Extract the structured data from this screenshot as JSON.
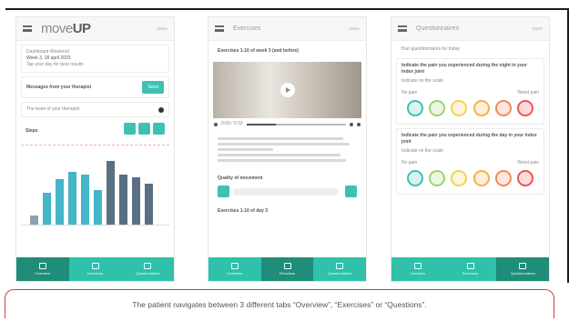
{
  "caption": "The patient navigates between 3 different tabs “Overview”, “Exercises” or “Questions”.",
  "colors": {
    "teal": "#3ec1b3",
    "teal_dark": "#208c7a",
    "bar_dark": "#5a6f82",
    "bar_light": "#45b5c8",
    "caption_border": "#d43a3a"
  },
  "phone1": {
    "logo_light": "move",
    "logo_bold": "UP",
    "card1": {
      "line1": "Dashboard Weekend",
      "line2": "Week 3, 18 april 2023",
      "line3": "Tap your day for best results"
    },
    "card2": {
      "message": "Messages from your therapist",
      "button": "Send"
    },
    "card3": {
      "text": "The team of your therapist"
    },
    "chart_header": "Steps",
    "tabs": [
      {
        "label": "Overview"
      },
      {
        "label": "Exercises"
      },
      {
        "label": "Questionnaires"
      }
    ]
  },
  "phone2": {
    "title": "Exercises",
    "heading": "Exercises 1-10 of week 3 (and before)",
    "video_time": "0:00 / 0:33",
    "quality_label": "Quality of movement",
    "footer_text": "Exercises 1-10 of day 3",
    "tabs": [
      {
        "label": "Overview"
      },
      {
        "label": "Exercises"
      },
      {
        "label": "Questionnaires"
      }
    ]
  },
  "phone3": {
    "title": "Questionnaires",
    "subtitle": "Your questionnaires for today",
    "q1": {
      "text": "Indicate the pain you experienced during the night in your index joint",
      "hint": "Indicate on the scale",
      "left": "No pain",
      "right": "Worst pain"
    },
    "q2": {
      "text": "Indicate the pain you experienced during the day in your index joint",
      "hint": "Indicate on the scale",
      "left": "No pain",
      "right": "Worst pain"
    },
    "face_colors": [
      "#3ec1b3",
      "#9fd46a",
      "#f4d24e",
      "#f5b04a",
      "#f08a5d",
      "#e9575b"
    ],
    "tabs": [
      {
        "label": "Overview"
      },
      {
        "label": "Exercises"
      },
      {
        "label": "Questionnaires"
      }
    ]
  }
}
